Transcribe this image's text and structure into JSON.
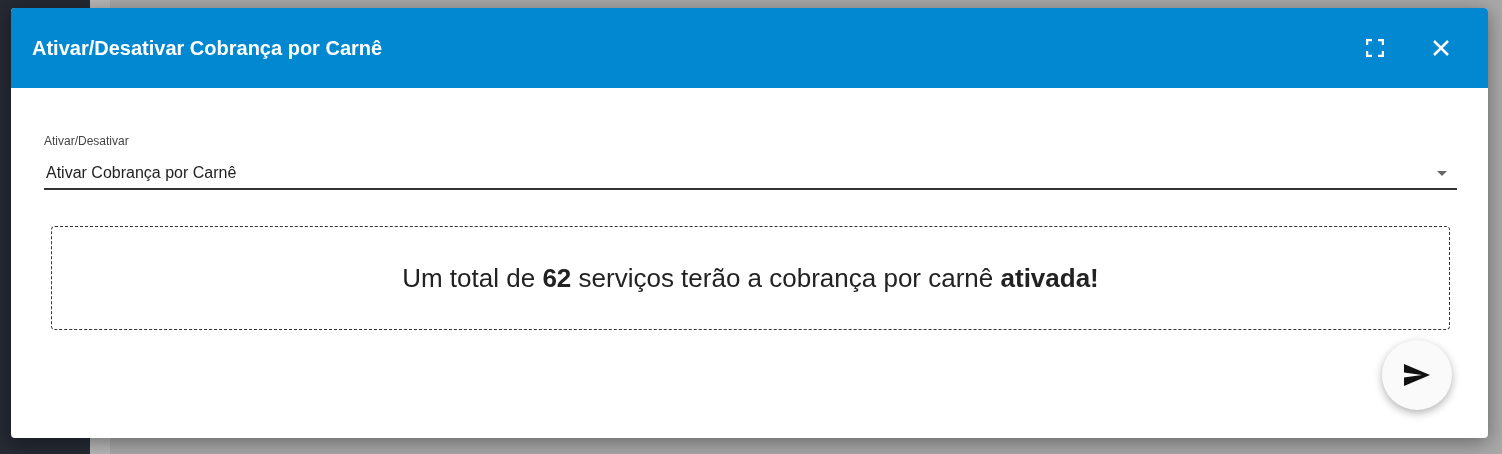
{
  "dialog": {
    "title": "Ativar/Desativar Cobrança por Carnê"
  },
  "select": {
    "label": "Ativar/Desativar",
    "value": "Ativar Cobrança por Carnê"
  },
  "summary": "Um total de **62** serviços terão a cobrança por carnê **ativada!**"
}
